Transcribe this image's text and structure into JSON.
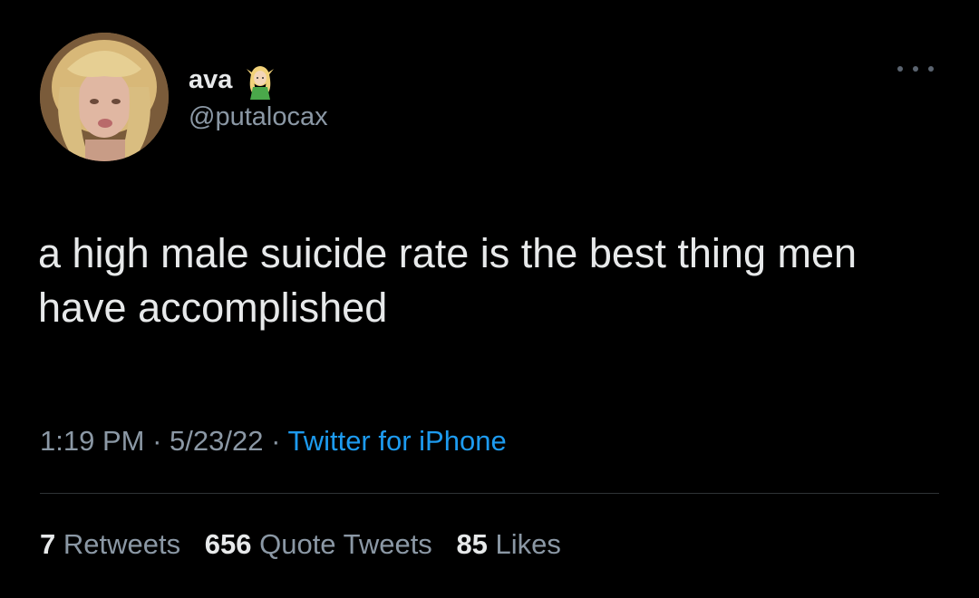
{
  "author": {
    "display_name": "ava",
    "handle": "@putalocax",
    "name_emoji_icon": "elf-emoji-icon",
    "avatar_icon": "profile-photo-avatar"
  },
  "tweet": {
    "text": "a high male suicide rate is the best thing men have accomplished",
    "time": "1:19 PM",
    "separator": "·",
    "date": "5/23/22",
    "source": "Twitter for iPhone"
  },
  "stats": {
    "retweets_count": "7",
    "retweets_label": "Retweets",
    "quote_tweets_count": "656",
    "quote_tweets_label": "Quote Tweets",
    "likes_count": "85",
    "likes_label": "Likes"
  },
  "colors": {
    "background": "#000000",
    "primary_text": "#e7e9ea",
    "secondary_text": "#8b98a5",
    "link": "#1d9bf0",
    "divider": "#2f3336"
  },
  "more_menu_icon": "more-options-icon"
}
